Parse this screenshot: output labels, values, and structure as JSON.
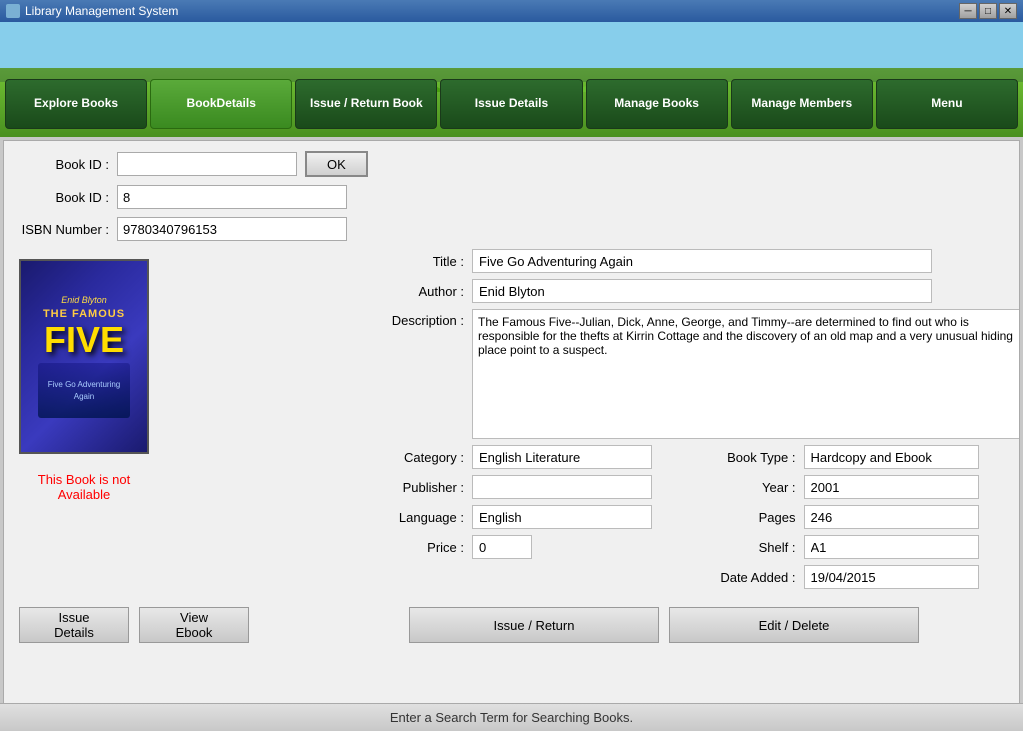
{
  "titleBar": {
    "title": "Library Management System",
    "minBtn": "─",
    "maxBtn": "□",
    "closeBtn": "✕"
  },
  "nav": {
    "items": [
      {
        "id": "explore-books",
        "label": "Explore Books",
        "active": false
      },
      {
        "id": "book-details",
        "label": "BookDetails",
        "active": true
      },
      {
        "id": "issue-return-book",
        "label": "Issue / Return Book",
        "active": false
      },
      {
        "id": "issue-details",
        "label": "Issue Details",
        "active": false
      },
      {
        "id": "manage-books",
        "label": "Manage Books",
        "active": false
      },
      {
        "id": "manage-members",
        "label": "Manage Members",
        "active": false
      },
      {
        "id": "menu",
        "label": "Menu",
        "active": false
      }
    ]
  },
  "form": {
    "bookIdLabel": "Book ID :",
    "bookIdSearchValue": "",
    "okBtnLabel": "OK",
    "bookIdLabel2": "Book ID :",
    "bookIdValue": "8",
    "isbnLabel": "ISBN Number :",
    "isbnValue": "9780340796153"
  },
  "bookCover": {
    "author": "Enid Blyton",
    "series": "THE FAMOUS",
    "titleLine1": "FIVE",
    "subtitle": "Five Go Adventuring Again"
  },
  "availability": {
    "message": "This Book is not Available"
  },
  "details": {
    "titleLabel": "Title :",
    "titleValue": "Five Go Adventuring Again",
    "authorLabel": "Author :",
    "authorValue": "Enid Blyton",
    "descriptionLabel": "Description :",
    "descriptionValue": "The Famous Five--Julian, Dick, Anne, George, and Timmy--are determined to find out who is responsible for the thefts at Kirrin Cottage and the discovery of an old map and a very unusual hiding place point to a suspect.",
    "categoryLabel": "Category :",
    "categoryValue": "English Literature",
    "publisherLabel": "Publisher :",
    "publisherValue": "",
    "languageLabel": "Language :",
    "languageValue": "English",
    "priceLabel": "Price :",
    "priceValue": "0",
    "bookTypeLabel": "Book Type :",
    "bookTypeValue": "Hardcopy and Ebook",
    "yearLabel": "Year :",
    "yearValue": "2001",
    "pagesLabel": "Pages",
    "pagesValue": "246",
    "shelfLabel": "Shelf :",
    "shelfValue": "A1",
    "dateAddedLabel": "Date Added :",
    "dateAddedValue": "19/04/2015"
  },
  "buttons": {
    "issueDetails": "Issue Details",
    "viewEbook": "View Ebook",
    "issueReturn": "Issue / Return",
    "editDelete": "Edit / Delete"
  },
  "statusBar": {
    "message": "Enter a Search Term for Searching Books."
  }
}
